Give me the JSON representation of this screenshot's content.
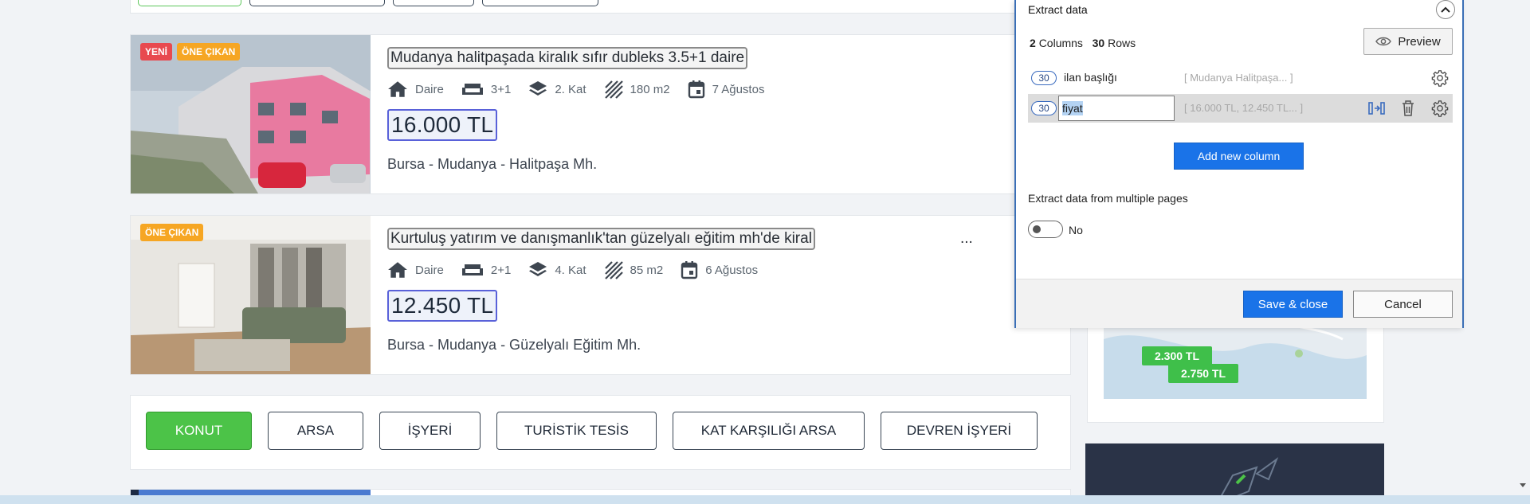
{
  "listings": [
    {
      "badges": [
        "YENİ",
        "ÖNE ÇIKAN"
      ],
      "title": "Mudanya halitpaşada kiralık sıfır dubleks 3.5+1 daire",
      "specs": {
        "type": "Daire",
        "rooms": "3+1",
        "floor": "2. Kat",
        "area": "180 m2",
        "date": "7 Ağustos"
      },
      "price": "16.000 TL",
      "location": "Bursa - Mudanya - Halitpaşa Mh."
    },
    {
      "badges": [
        "ÖNE ÇIKAN"
      ],
      "title": "Kurtuluş yatırım ve danışmanlık'tan güzelyalı eğitim mh'de kiral",
      "title_ellipsis": "...",
      "specs": {
        "type": "Daire",
        "rooms": "2+1",
        "floor": "4. Kat",
        "area": "85 m2",
        "date": "6 Ağustos"
      },
      "price": "12.450 TL",
      "location": "Bursa - Mudanya - Güzelyalı Eğitim Mh."
    }
  ],
  "categories": [
    {
      "label": "KONUT",
      "active": true
    },
    {
      "label": "ARSA",
      "active": false
    },
    {
      "label": "İŞYERİ",
      "active": false
    },
    {
      "label": "TURİSTİK TESİS",
      "active": false
    },
    {
      "label": "KAT KARŞILIĞI ARSA",
      "active": false
    },
    {
      "label": "DEVREN İŞYERİ",
      "active": false
    }
  ],
  "map": {
    "pins": [
      "2.300 TL",
      "2.750 TL"
    ]
  },
  "extract_panel": {
    "title": "Extract data",
    "columns_count": "2",
    "columns_label": "Columns",
    "rows_count": "30",
    "rows_label": "Rows",
    "preview_label": "Preview",
    "columns": [
      {
        "count": "30",
        "name": "ilan başlığı",
        "sample": "[ Mudanya Halitpaşa... ]"
      },
      {
        "count": "30",
        "name": "fiyat",
        "sample": "[ 16.000 TL, 12.450 TL... ]"
      }
    ],
    "add_column_label": "Add new column",
    "multi_pages_label": "Extract data from multiple pages",
    "toggle_value": "No",
    "save_label": "Save & close",
    "cancel_label": "Cancel"
  },
  "colors": {
    "accent_blue": "#1a73e8",
    "active_green": "#4cc348",
    "badge_red": "#e8494f",
    "badge_orange": "#f6a623"
  }
}
